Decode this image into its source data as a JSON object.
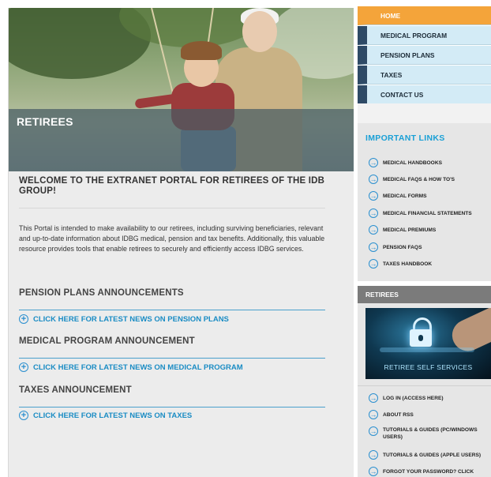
{
  "hero": {
    "title": "RETIREES"
  },
  "main": {
    "welcome": "WELCOME TO THE EXTRANET PORTAL FOR RETIREES OF THE IDB GROUP!",
    "intro": "This Portal is intended to make availability to our retirees, including surviving beneficiaries, relevant and up-to-date information about IDBG medical, pension and tax benefits. Additionally, this valuable resource provides tools that enable retirees to securely and efficiently access IDBG services.",
    "sections": [
      {
        "title": "PENSION PLANS ANNOUNCEMENTS",
        "link": "CLICK HERE FOR LATEST NEWS ON PENSION PLANS"
      },
      {
        "title": "MEDICAL PROGRAM ANNOUNCEMENT",
        "link": "CLICK HERE FOR LATEST NEWS ON MEDICAL PROGRAM"
      },
      {
        "title": "TAXES ANNOUNCEMENT",
        "link": "CLICK HERE FOR LATEST NEWS ON TAXES"
      }
    ]
  },
  "nav": {
    "items": [
      "HOME",
      "MEDICAL PROGRAM",
      "PENSION PLANS",
      "TAXES",
      "CONTACT US"
    ],
    "active_index": 0
  },
  "important_links": {
    "title": "IMPORTANT LINKS",
    "items": [
      "MEDICAL HANDBOOKS",
      "MEDICAL FAQS & HOW TO'S",
      "MEDICAL FORMS",
      "MEDICAL FINANCIAL STATEMENTS",
      "MEDICAL PREMIUMS",
      "PENSION FAQS",
      "TAXES HANDBOOK"
    ]
  },
  "retirees_box": {
    "title": "RETIREES",
    "image_label": "RETIREE SELF SERVICES",
    "items": [
      "LOG IN (ACCESS HERE)",
      "ABOUT RSS",
      "TUTORIALS & GUIDES (PC/WINDOWS USERS)",
      "TUTORIALS & GUIDES (APPLE USERS)",
      "FORGOT YOUR PASSWORD? CLICK"
    ]
  },
  "colors": {
    "accent_orange": "#f4a43a",
    "link_blue": "#1a8cc4",
    "nav_bg": "#d3ebf6",
    "nav_dark": "#2e4a66"
  },
  "icons": {
    "link_arrow": "circle-plus-icon",
    "side_arrow": "circle-arrow-icon"
  }
}
